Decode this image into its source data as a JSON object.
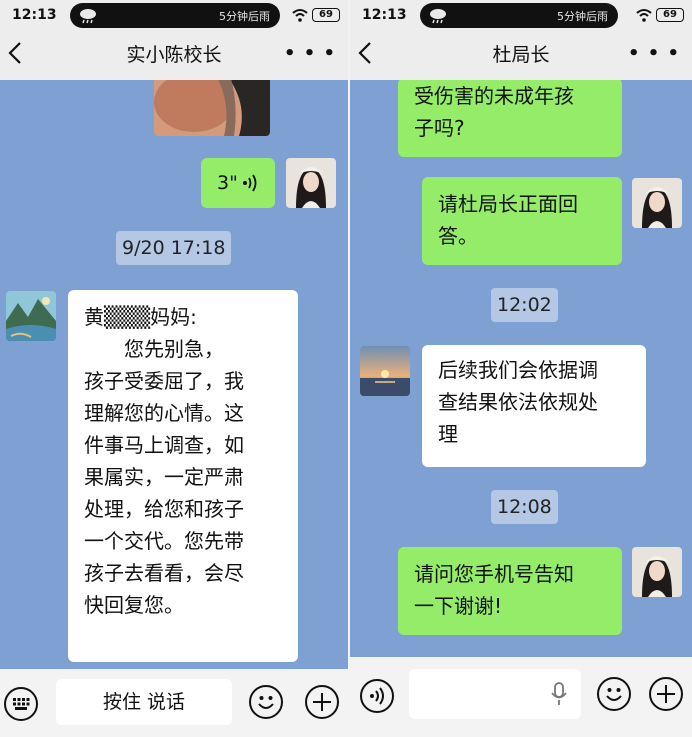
{
  "left": {
    "status": {
      "time": "12:13",
      "pill_text": "5分钟后雨",
      "battery": "69"
    },
    "title": "实小陈校长",
    "voice_duration": "3\"",
    "timestamp": "9/20 17:18",
    "message_lines": [
      "黄▒▒▒妈妈:",
      "　　您先别急，",
      "孩子受委屈了，我",
      "理解您的心情。这",
      "件事马上调查，如",
      "果属实，一定严肃",
      "处理，给您和孩子",
      "一个交代。您先带",
      "孩子去看看，会尽",
      "快回复您。"
    ],
    "hold_to_talk": "按住 说话"
  },
  "right": {
    "status": {
      "time": "12:13",
      "pill_text": "5分钟后雨",
      "battery": "69"
    },
    "title": "杜局长",
    "messages": [
      {
        "lines": "受伤害的未成年孩\n子吗?"
      },
      {
        "lines": "请杜局长正面回\n答。"
      },
      {
        "time": "12:02"
      },
      {
        "lines": "后续我们会依据调\n查结果依法依规处\n理"
      },
      {
        "time": "12:08"
      },
      {
        "lines": "请问您手机号告知\n一下谢谢!"
      }
    ]
  },
  "colors": {
    "chat_bg": "#7fa0d2",
    "sent_bubble": "#95ec69",
    "received_bubble": "#ffffff",
    "topbar": "#ededed"
  }
}
